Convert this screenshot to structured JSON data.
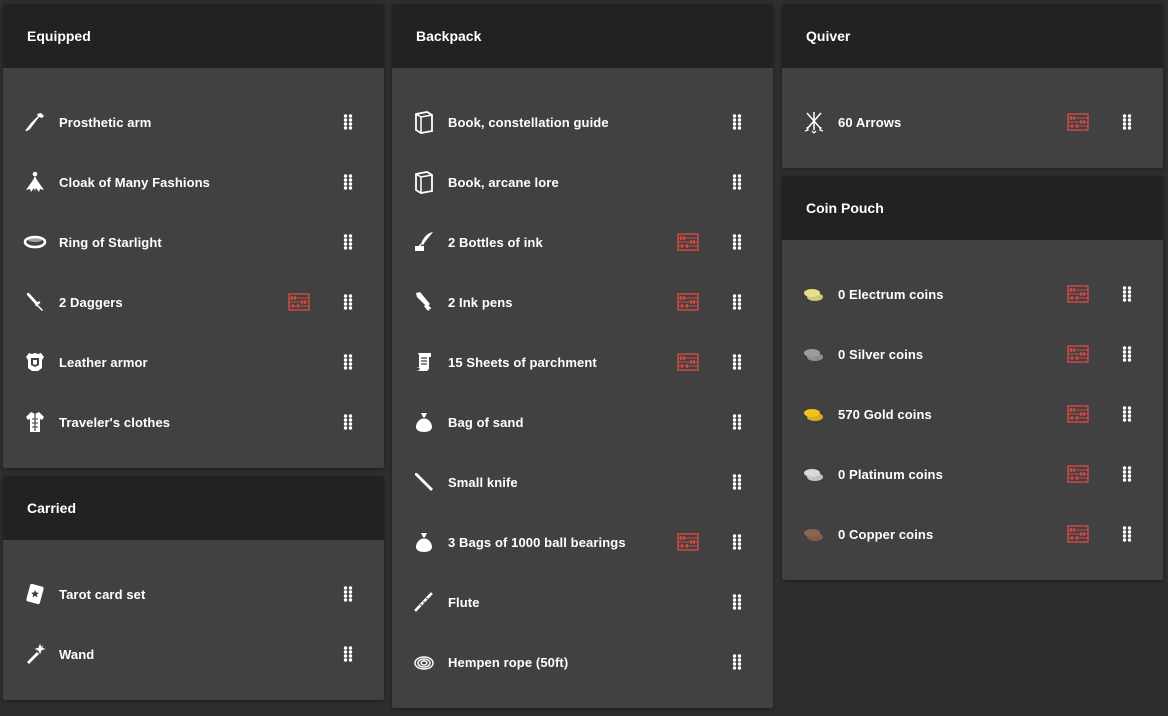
{
  "colors": {
    "background": "#2e2e2e",
    "panel": "#414141",
    "header": "#222222",
    "text": "#ffffff",
    "abacus": "#d64a43",
    "electrum": "#e8df8a",
    "silver": "#9c9c9c",
    "gold": "#f2c21c",
    "platinum": "#d9d9d9",
    "copper": "#8a6550"
  },
  "equipped": {
    "title": "Equipped",
    "items": [
      {
        "label": "Prosthetic arm",
        "icon": "prosthetic-arm-icon",
        "abacus": false
      },
      {
        "label": "Cloak of Many Fashions",
        "icon": "cloak-icon",
        "abacus": false
      },
      {
        "label": "Ring of Starlight",
        "icon": "ring-icon",
        "abacus": false
      },
      {
        "label": "2 Daggers",
        "icon": "dagger-icon",
        "abacus": true
      },
      {
        "label": "Leather armor",
        "icon": "armor-icon",
        "abacus": false
      },
      {
        "label": "Traveler's clothes",
        "icon": "clothes-icon",
        "abacus": false
      }
    ]
  },
  "carried": {
    "title": "Carried",
    "items": [
      {
        "label": "Tarot card set",
        "icon": "tarot-card-icon",
        "abacus": false
      },
      {
        "label": "Wand",
        "icon": "wand-icon",
        "abacus": false
      }
    ]
  },
  "backpack": {
    "title": "Backpack",
    "items": [
      {
        "label": "Book, constellation guide",
        "icon": "book-icon",
        "abacus": false
      },
      {
        "label": "Book, arcane lore",
        "icon": "book-icon",
        "abacus": false
      },
      {
        "label": "2 Bottles of ink",
        "icon": "quill-ink-icon",
        "abacus": true
      },
      {
        "label": "2 Ink pens",
        "icon": "ink-pen-icon",
        "abacus": true
      },
      {
        "label": "15 Sheets of parchment",
        "icon": "scroll-icon",
        "abacus": true
      },
      {
        "label": "Bag of sand",
        "icon": "bag-icon",
        "abacus": false
      },
      {
        "label": "Small knife",
        "icon": "knife-icon",
        "abacus": false
      },
      {
        "label": "3 Bags of 1000 ball bearings",
        "icon": "bag-icon",
        "abacus": true
      },
      {
        "label": "Flute",
        "icon": "flute-icon",
        "abacus": false
      },
      {
        "label": "Hempen rope (50ft)",
        "icon": "rope-icon",
        "abacus": false
      }
    ]
  },
  "quiver": {
    "title": "Quiver",
    "items": [
      {
        "label": "60 Arrows",
        "icon": "arrows-icon",
        "abacus": true
      }
    ]
  },
  "coin_pouch": {
    "title": "Coin Pouch",
    "items": [
      {
        "label": "0 Electrum coins",
        "icon": "coins-icon",
        "coin": "electrum",
        "abacus": true
      },
      {
        "label": "0 Silver coins",
        "icon": "coins-icon",
        "coin": "silver",
        "abacus": true
      },
      {
        "label": "570 Gold coins",
        "icon": "coins-icon",
        "coin": "gold",
        "abacus": true
      },
      {
        "label": "0 Platinum coins",
        "icon": "coins-icon",
        "coin": "platinum",
        "abacus": true
      },
      {
        "label": "0 Copper coins",
        "icon": "coins-icon",
        "coin": "copper",
        "abacus": true
      }
    ]
  }
}
